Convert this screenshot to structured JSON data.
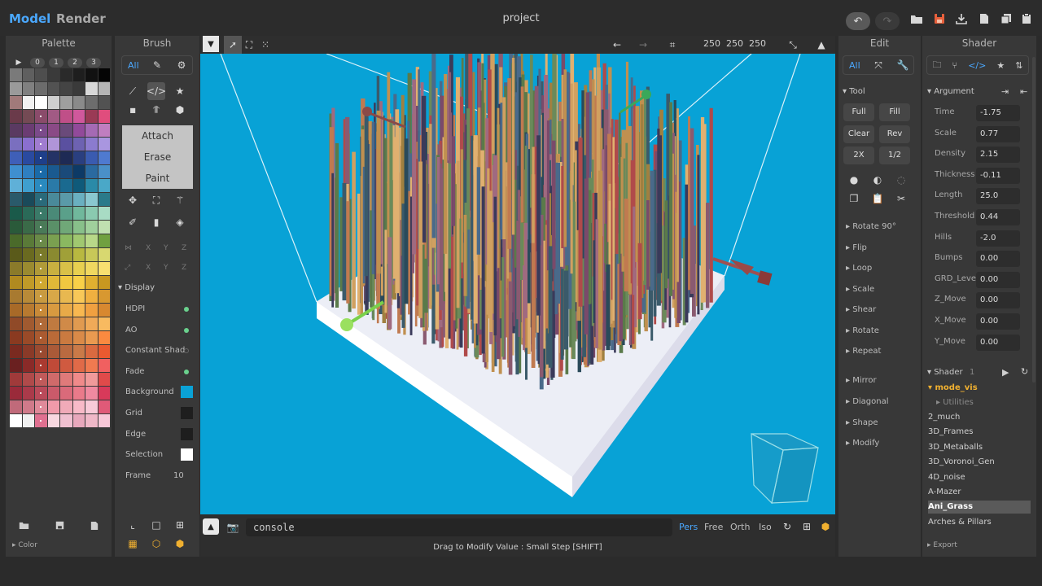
{
  "app": {
    "title": "project",
    "mode_tabs": [
      "Model",
      "Render"
    ],
    "toolbar_icons": [
      "undo-icon",
      "redo-icon",
      "folder-open-icon",
      "save-icon",
      "download-icon",
      "new-file-icon",
      "copy-icon",
      "paste-icon"
    ]
  },
  "palette": {
    "header": "Palette",
    "tabs": [
      "▶",
      "0",
      "1",
      "2",
      "3"
    ],
    "footer": "Color",
    "swatches": [
      "#7a7a7a",
      "#5f5f5f",
      "#4e4e4e",
      "#3a3a3a",
      "#2a2a2a",
      "#1e1e1e",
      "#111111",
      "#050505",
      "#9a9a9a",
      "#808080",
      "#6c6c6c",
      "#525252",
      "#444444",
      "#3a3a3a",
      "#d8d8d8",
      "#b5b5b5",
      "#a17a7a",
      "#f2f2f2",
      "#ffffff",
      "#cfcfcf",
      "#9f9f9f",
      "#8a8a8a",
      "#6d6d6d",
      "#525252",
      "#6a3a4a",
      "#744a54",
      "#8a4b6a",
      "#a15a84",
      "#c04f88",
      "#d0589c",
      "#9a3a55",
      "#e04d7d",
      "#5a3a62",
      "#6b3c73",
      "#7b4a8a",
      "#8a4a86",
      "#6a4a7a",
      "#924a9a",
      "#a56ab4",
      "#c07ec0",
      "#7a6fbf",
      "#8a6fcf",
      "#a07cd0",
      "#b095d8",
      "#5a50a0",
      "#6d62b2",
      "#8b7bcf",
      "#a996e0",
      "#3f5fb8",
      "#2a4aa0",
      "#1e3f8a",
      "#243366",
      "#1e2a55",
      "#2a3f80",
      "#3a5bb0",
      "#4f7ad0",
      "#3f8fcf",
      "#2f7fc0",
      "#1a6aa8",
      "#1a5a90",
      "#1a4a7a",
      "#0d3a66",
      "#2a6aa0",
      "#4a90c8",
      "#5fb0d8",
      "#3f9fcf",
      "#2a8abf",
      "#2a7aa8",
      "#1a6a90",
      "#0f5a7a",
      "#2a8aa8",
      "#4aa8c8",
      "#2a5a6a",
      "#1a4a5a",
      "#2a6a7a",
      "#4a8a9a",
      "#5a9aa8",
      "#6ab0c0",
      "#8ac8d0",
      "#2a7a8a",
      "#1a5a4a",
      "#2a6a58",
      "#3a7a68",
      "#4a8a78",
      "#5aa08a",
      "#70b89c",
      "#8acab0",
      "#a8dcc4",
      "#2a5a3a",
      "#3a6a48",
      "#4a7a58",
      "#5a9068",
      "#70a878",
      "#88c08a",
      "#a0d09c",
      "#c0e0b0",
      "#4a6a2a",
      "#5a7a38",
      "#6a8a48",
      "#7aa050",
      "#8ab860",
      "#a0c870",
      "#b8d888",
      "#70a040",
      "#5a5a1a",
      "#6a6a20",
      "#7a7a2a",
      "#8a8a30",
      "#a0a038",
      "#b8b840",
      "#c8c858",
      "#d8d870",
      "#8a7a2a",
      "#9a8a30",
      "#b09a38",
      "#c8b040",
      "#d8c048",
      "#e8d050",
      "#f0d860",
      "#f8e070",
      "#b08a20",
      "#c09a28",
      "#d0a830",
      "#e0b838",
      "#f0c840",
      "#f8d048",
      "#e0b030",
      "#c89820",
      "#a87a30",
      "#b88a38",
      "#c89a40",
      "#d8a848",
      "#e8b850",
      "#f8c858",
      "#f0b040",
      "#d89830",
      "#a86a28",
      "#b87a30",
      "#c88a38",
      "#d89a40",
      "#e8aa48",
      "#f8b850",
      "#f0a040",
      "#d88830",
      "#904a28",
      "#a05a30",
      "#b06a38",
      "#c07a40",
      "#d08a48",
      "#e09a50",
      "#f0aa58",
      "#f8ba60",
      "#8a3a20",
      "#9a4a28",
      "#aa5a30",
      "#ba6a38",
      "#ca7a40",
      "#da8a48",
      "#ea9a50",
      "#fa8a40",
      "#7a2a20",
      "#8a3a28",
      "#9a4a30",
      "#aa5a38",
      "#ba6a40",
      "#ca7a48",
      "#da6a40",
      "#ea5a30",
      "#6a2020",
      "#8a2a28",
      "#aa3a30",
      "#c04a38",
      "#d05a40",
      "#e06a48",
      "#f07a50",
      "#f06060",
      "#a03a3a",
      "#b04a4a",
      "#c05a5a",
      "#d06a6a",
      "#e07a7a",
      "#f08a8a",
      "#f09a9a",
      "#e04a4a",
      "#9a2a3a",
      "#aa3a4a",
      "#ba4a5a",
      "#ca5a6a",
      "#da6a7a",
      "#ea7a8a",
      "#f08aa0",
      "#d83a5a",
      "#c06a7a",
      "#d07a8a",
      "#e08a9a",
      "#f09aaa",
      "#f0aab8",
      "#f8bac8",
      "#f8cad8",
      "#e05a78",
      "#ffffff",
      "#f0f0f0",
      "#e07090",
      "#f8d8e0",
      "#f0c0d0",
      "#e8a8bc",
      "#f0b8c8",
      "#f8c8d8"
    ]
  },
  "brush": {
    "header": "Brush",
    "filter_label": "All",
    "modes": [
      "Attach",
      "Erase",
      "Paint"
    ],
    "axes_row1": [
      "X",
      "Y",
      "Z"
    ],
    "axes_row2": [
      "X",
      "Y",
      "Z"
    ],
    "display_title": "Display",
    "display": {
      "hdpi": "HDPI",
      "ao": "AO",
      "constant_shad": "Constant Shad",
      "fade": "Fade",
      "background": "Background",
      "grid": "Grid",
      "edge": "Edge",
      "selection": "Selection",
      "frame": "Frame",
      "frame_value": "10"
    },
    "colors": {
      "background": "#0aa2d6",
      "grid": "#1e1e1e",
      "edge": "#1e1e1e",
      "selection": "#ffffff"
    }
  },
  "viewport": {
    "dims": "250  250  250",
    "background": "#08a2d6"
  },
  "status": {
    "console": "console",
    "view_modes": [
      "Pers",
      "Free",
      "Orth",
      "Iso"
    ],
    "hint": "Drag to Modify Value : Small Step [SHIFT]"
  },
  "edit": {
    "header": "Edit",
    "filter_label": "All",
    "tool_title": "Tool",
    "buttons": [
      "Full",
      "Fill",
      "Clear",
      "Rev",
      "2X",
      "1/2"
    ],
    "sections": [
      "Rotate 90°",
      "Flip",
      "Loop",
      "Scale",
      "Shear",
      "Rotate",
      "Repeat",
      "Mirror",
      "Diagonal",
      "Shape",
      "Modify"
    ]
  },
  "shader": {
    "header": "Shader",
    "argument_title": "Argument",
    "arguments": [
      {
        "label": "Time",
        "value": "-1.75"
      },
      {
        "label": "Scale",
        "value": "0.77"
      },
      {
        "label": "Density",
        "value": "2.15"
      },
      {
        "label": "Thickness",
        "value": "-0.11"
      },
      {
        "label": "Length",
        "value": "25.0"
      },
      {
        "label": "Threshold",
        "value": "0.44"
      },
      {
        "label": "Hills",
        "value": "-2.0"
      },
      {
        "label": "Bumps",
        "value": "0.00"
      },
      {
        "label": "GRD_Level",
        "value": "0.00"
      },
      {
        "label": "Z_Move",
        "value": "0.00"
      },
      {
        "label": "X_Move",
        "value": "0.00"
      },
      {
        "label": "Y_Move",
        "value": "0.00"
      }
    ],
    "list_title": "Shader",
    "list_count": "1",
    "folder": "mode_vis",
    "subfolder": "Utilities",
    "items": [
      "2_much",
      "3D_Frames",
      "3D_Metaballs",
      "3D_Voronoi_Gen",
      "4D_noise",
      "A-Mazer",
      "Ani_Grass",
      "Arches & Pillars"
    ],
    "selected": "Ani_Grass",
    "footer": "Export"
  }
}
